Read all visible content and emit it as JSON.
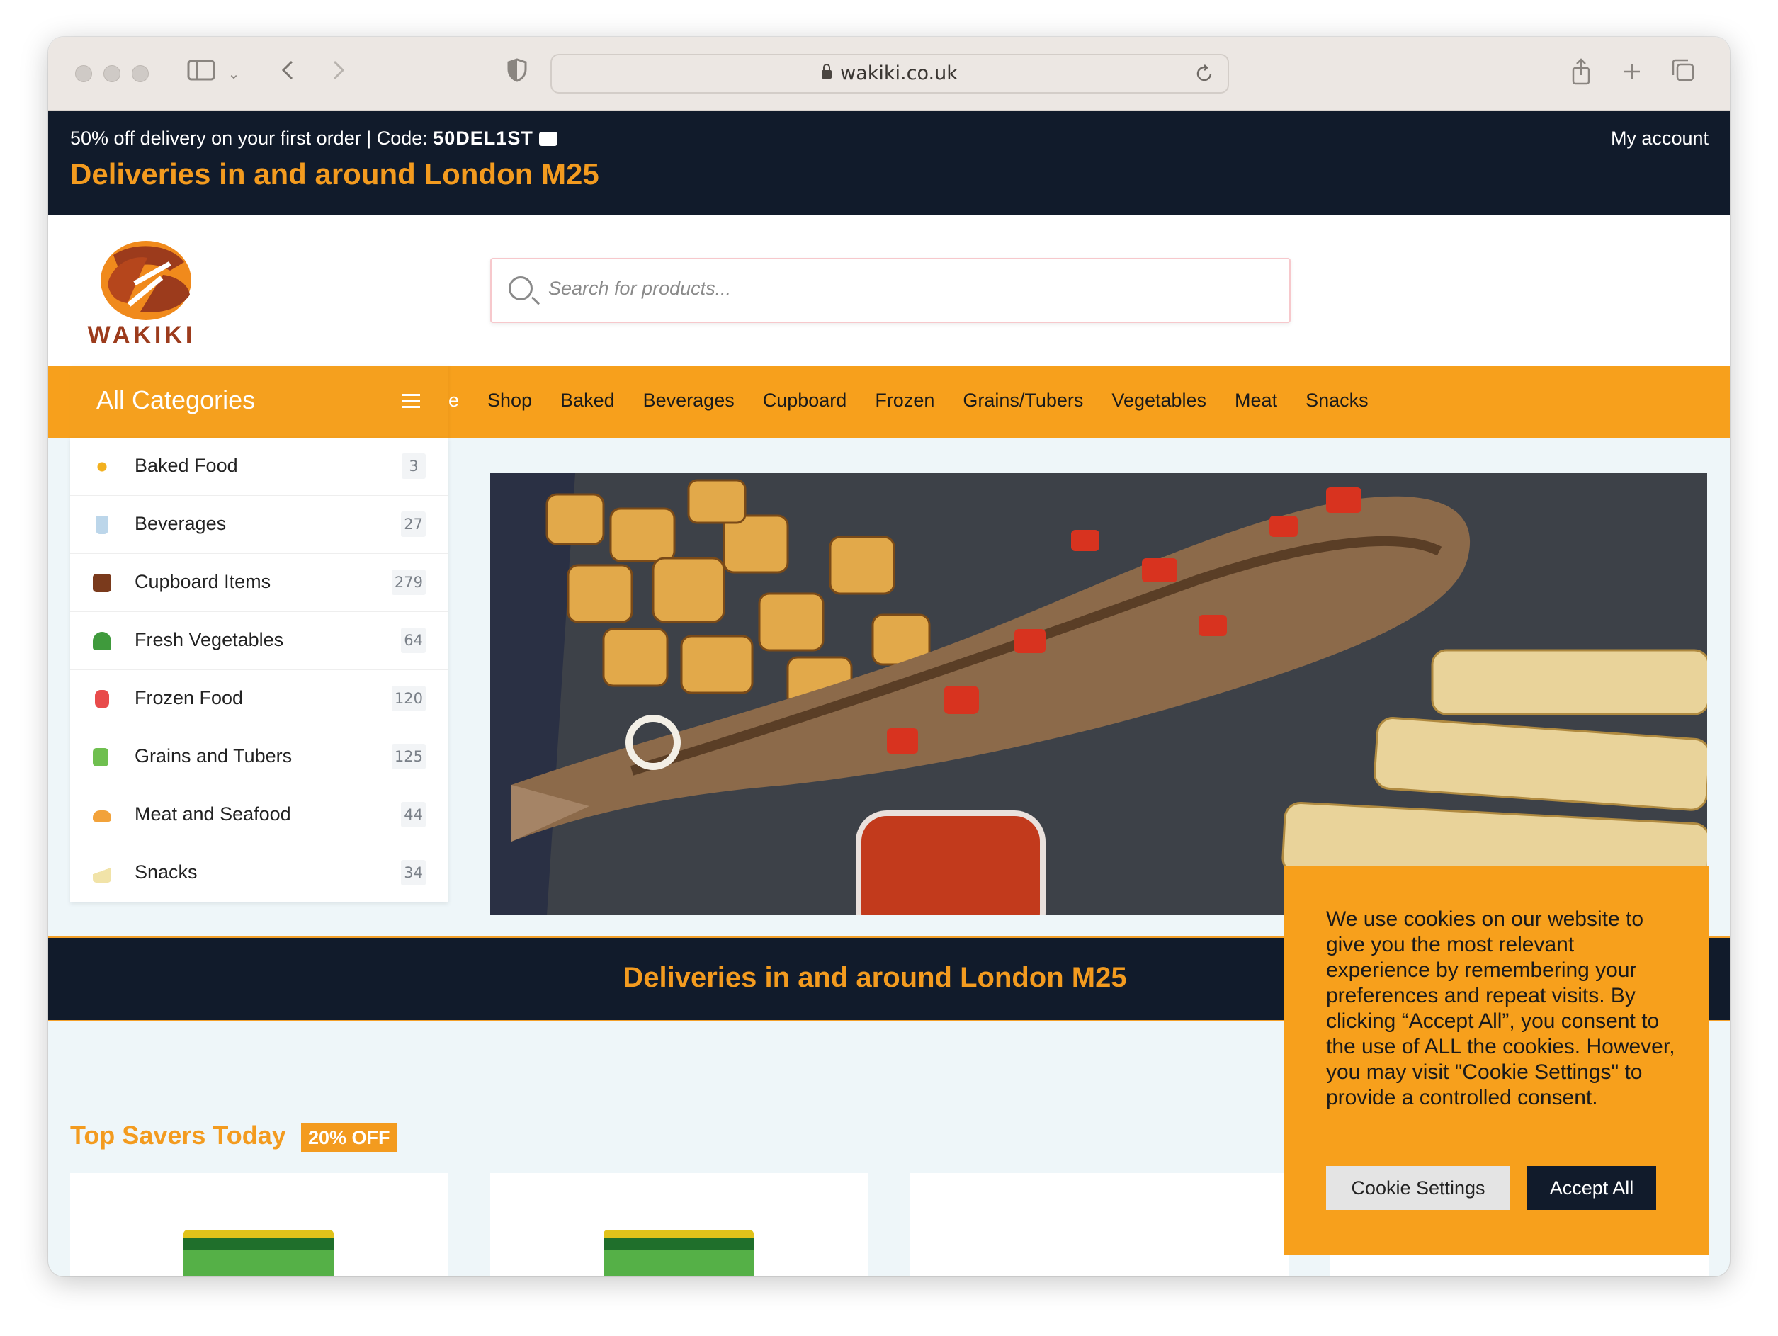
{
  "browser": {
    "url": "wakiki.co.uk"
  },
  "topbar": {
    "promo_text": "50% off delivery on your first order | Code: ",
    "promo_code": "50DEL1ST",
    "delivery_text": "Deliveries in and around London M25",
    "my_account": "My account"
  },
  "header": {
    "logo_text": "WAKIKI",
    "search_placeholder": "Search for products..."
  },
  "nav": {
    "all_categories": "All Categories",
    "partial_item": "e",
    "items": [
      "Shop",
      "Baked",
      "Beverages",
      "Cupboard",
      "Frozen",
      "Grains/Tubers",
      "Vegetables",
      "Meat",
      "Snacks"
    ]
  },
  "categories": [
    {
      "label": "Baked Food",
      "count": "3",
      "icon": "baked-food-icon",
      "color": "#f2b01e"
    },
    {
      "label": "Beverages",
      "count": "27",
      "icon": "beverages-icon",
      "color": "#bcd6ea"
    },
    {
      "label": "Cupboard Items",
      "count": "279",
      "icon": "cupboard-icon",
      "color": "#7a3a1c"
    },
    {
      "label": "Fresh Vegetables",
      "count": "64",
      "icon": "vegetables-icon",
      "color": "#3f9a3c"
    },
    {
      "label": "Frozen Food",
      "count": "120",
      "icon": "frozen-food-icon",
      "color": "#e84b4b"
    },
    {
      "label": "Grains and Tubers",
      "count": "125",
      "icon": "grains-icon",
      "color": "#6fbf4f"
    },
    {
      "label": "Meat and Seafood",
      "count": "44",
      "icon": "meat-icon",
      "color": "#f2a23a"
    },
    {
      "label": "Snacks",
      "count": "34",
      "icon": "snacks-icon",
      "color": "#f1e3a8"
    }
  ],
  "band": {
    "text": "Deliveries in and around London M25"
  },
  "savers": {
    "title": "Top Savers Today",
    "badge": "20% OFF"
  },
  "cookie": {
    "text": "We use cookies on our website to give you the most relevant experience by remembering your preferences and repeat visits. By clicking “Accept All”, you consent to the use of ALL the cookies. However, you may visit \"Cookie Settings\" to provide a controlled consent.",
    "settings_label": "Cookie Settings",
    "accept_label": "Accept All"
  },
  "colors": {
    "brand_orange": "#f7a01c",
    "navy": "#111b2b",
    "accent_text": "#f39b1f"
  }
}
